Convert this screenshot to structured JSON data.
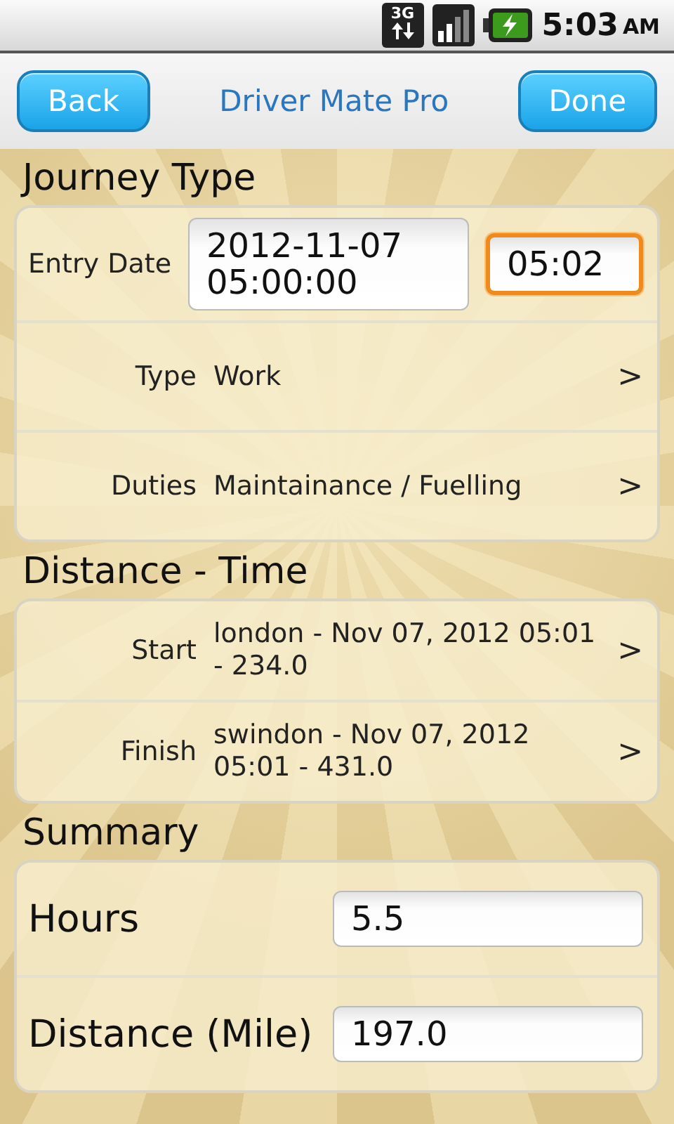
{
  "status_bar": {
    "network": "3G",
    "time": "5:03",
    "ampm": "AM"
  },
  "header": {
    "back": "Back",
    "title": "Driver Mate Pro",
    "done": "Done"
  },
  "journey": {
    "heading": "Journey Type",
    "entry_date": {
      "label": "Entry Date",
      "date": "2012-11-07 05:00:00",
      "time": "05:02",
      "date_focused": false,
      "time_focused": true
    },
    "rows": [
      {
        "label": "Type",
        "value": "Work",
        "chevron": ">"
      },
      {
        "label": "Duties",
        "value": "Maintainance / Fuelling",
        "chevron": ">"
      }
    ]
  },
  "distance": {
    "heading": "Distance - Time",
    "rows": [
      {
        "label": "Start",
        "value": "london - Nov 07, 2012 05:01 - 234.0",
        "chevron": ">"
      },
      {
        "label": "Finish",
        "value": "swindon - Nov 07, 2012 05:01 - 431.0",
        "chevron": ">"
      }
    ]
  },
  "summary": {
    "heading": "Summary",
    "fields": [
      {
        "label": "Hours",
        "value": "5.5",
        "focused": false
      },
      {
        "label": "Distance (Mile)",
        "value": "197.0",
        "focused": false
      }
    ]
  }
}
